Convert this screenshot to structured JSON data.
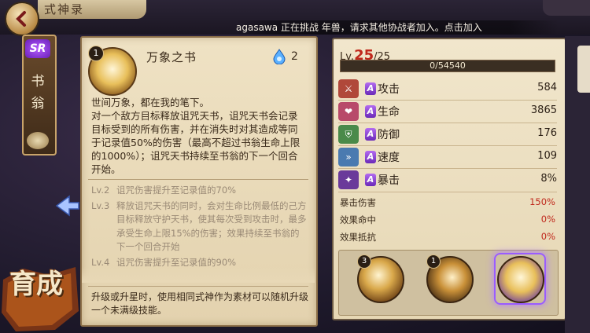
{
  "header": {
    "title": "式神录",
    "notice": "agasawa 正在挑战 年兽，请求其他协战者加入。点击加入"
  },
  "shikigami": {
    "rarity": "SR",
    "name_chars": [
      "书",
      "翁"
    ]
  },
  "skill": {
    "level": "1",
    "name": "万象之书",
    "orb_cost": "2",
    "description": "世间万象，都在我的笔下。\n对一个敌方目标释放诅咒天书，诅咒天书会记录目标受到的所有伤害，并在消失时对其造成等同于记录值50%的伤害（最高不超过书翁生命上限的1000%）；诅咒天书持续至书翁的下一个回合开始。",
    "upgrades": [
      {
        "level": "Lv.2",
        "text": "诅咒伤害提升至记录值的70%"
      },
      {
        "level": "Lv.3",
        "text": "释放诅咒天书的同时，会对生命比例最低的己方目标释放守护天书，使其每次受到攻击时，最多承受生命上限15%的伤害；效果持续至书翁的下一个回合开始"
      },
      {
        "level": "Lv.4",
        "text": "诅咒伤害提升至记录值的90%"
      }
    ],
    "note": "升级或升星时，使用相同式神作为素材可以随机升级一个未满级技能。"
  },
  "growth_label": "育成",
  "stats": {
    "level_label": "Lv.",
    "level_current": "25",
    "level_max": "/25",
    "exp_text": "0/54540",
    "exp_fraction": 0,
    "grade": "A",
    "main": [
      {
        "name": "攻击",
        "value": "584",
        "icon": "attack-icon",
        "color": "#b0483a"
      },
      {
        "name": "生命",
        "value": "3865",
        "icon": "health-icon",
        "color": "#b84a6a"
      },
      {
        "name": "防御",
        "value": "176",
        "icon": "defense-icon",
        "color": "#4a8a4a"
      },
      {
        "name": "速度",
        "value": "109",
        "icon": "speed-icon",
        "color": "#4a7ab0"
      },
      {
        "name": "暴击",
        "value": "8%",
        "icon": "crit-icon",
        "color": "#6a3a9a"
      }
    ],
    "sub": [
      {
        "name": "暴击伤害",
        "value": "150%"
      },
      {
        "name": "效果命中",
        "value": "0%"
      },
      {
        "name": "效果抵抗",
        "value": "0%"
      }
    ]
  },
  "souls": [
    {
      "level": "3",
      "icon": "skill-one-icon"
    },
    {
      "level": "1",
      "icon": "skill-two-icon"
    },
    {
      "level": "",
      "icon": "skill-three-icon"
    }
  ]
}
